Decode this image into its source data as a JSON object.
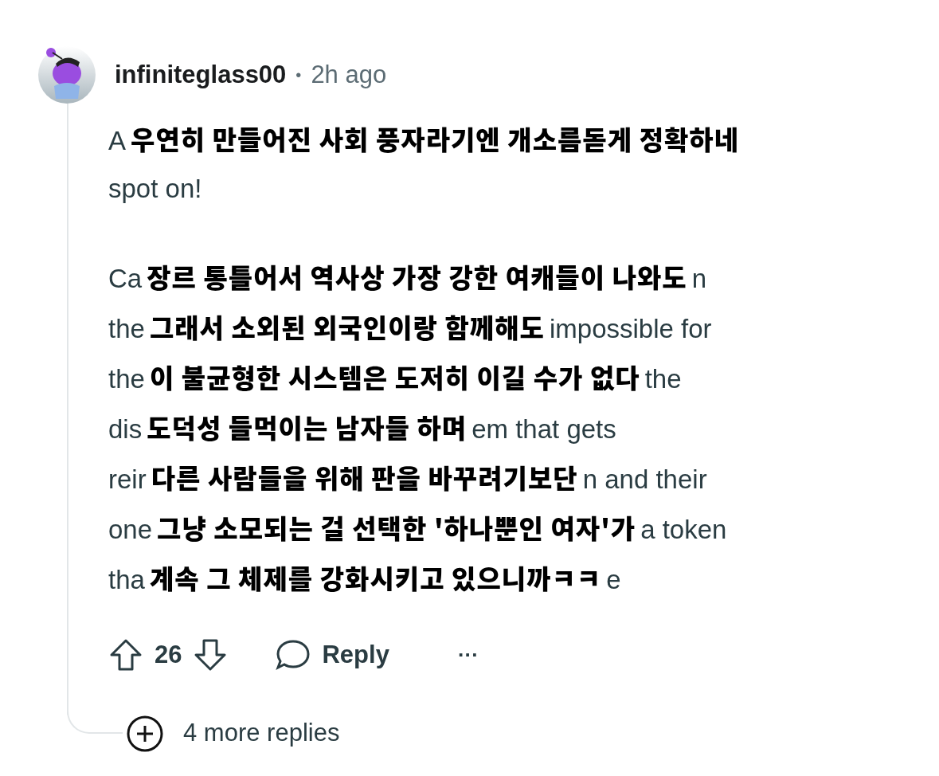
{
  "comment": {
    "author": "infiniteglass00",
    "separator": "•",
    "time": "2h ago",
    "paragraphs": [
      [
        {
          "prefix": "A",
          "overlay": "우연히 만들어진 사회 풍자라기엔 개소름돋게 정확하네"
        },
        {
          "prefix": "spot on!"
        }
      ],
      [
        {
          "prefix": "Ca",
          "overlay": "장르 통틀어서 역사상 가장 강한 여캐들이 나와도",
          "suffix": "n"
        },
        {
          "prefix": "the",
          "overlay": "그래서 소외된 외국인이랑 함께해도",
          "suffix": "impossible for"
        },
        {
          "prefix": "the",
          "overlay": "이 불균형한 시스템은 도저히 이길 수가 없다",
          "suffix": "the"
        },
        {
          "prefix": "dis",
          "overlay": "도덕성 들먹이는 남자들 하며",
          "suffix": "em that gets"
        },
        {
          "prefix": "reir",
          "overlay": "다른 사람들을 위해 판을 바꾸려기보단",
          "suffix": "n and their"
        },
        {
          "prefix": "one",
          "overlay": "그냥 소모되는 걸 선택한 '하나뿐인 여자'가",
          "suffix": "a token"
        },
        {
          "prefix": "tha",
          "overlay": "계속 그 체제를 강화시키고 있으니까ㅋㅋ",
          "suffix": "e"
        }
      ]
    ],
    "score": "26",
    "reply_label": "Reply",
    "more_label": "···"
  },
  "more_replies": {
    "label": "4 more replies"
  }
}
